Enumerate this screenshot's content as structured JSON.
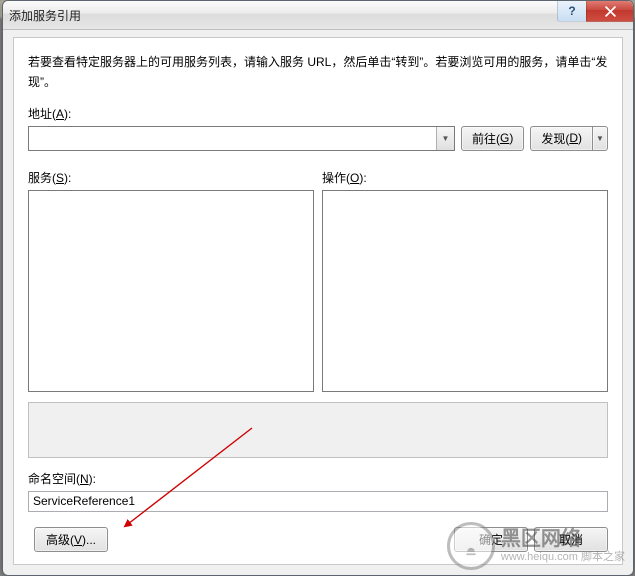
{
  "window": {
    "title": "添加服务引用"
  },
  "titlebar_buttons": {
    "help_glyph": "?",
    "close_aria": "Close"
  },
  "instructions": "若要查看特定服务器上的可用服务列表，请输入服务 URL，然后单击“转到”。若要浏览可用的服务，请单击“发现”。",
  "address": {
    "label_pre": "地址(",
    "label_u": "A",
    "label_post": "):",
    "value": ""
  },
  "buttons": {
    "go_pre": "前往(",
    "go_u": "G",
    "go_post": ")",
    "discover_pre": "发现(",
    "discover_u": "D",
    "discover_post": ")",
    "advanced_pre": "高级(",
    "advanced_u": "V",
    "advanced_post": ")...",
    "ok": "确定",
    "cancel": "取消"
  },
  "services": {
    "label_pre": "服务(",
    "label_u": "S",
    "label_post": "):"
  },
  "operations": {
    "label_pre": "操作(",
    "label_u": "O",
    "label_post": "):"
  },
  "namespace": {
    "label_pre": "命名空间(",
    "label_u": "N",
    "label_post": "):",
    "value": "ServiceReference1"
  },
  "watermark": {
    "big": "黑区网络",
    "small": "www.heiqu.com 脚本之家"
  }
}
